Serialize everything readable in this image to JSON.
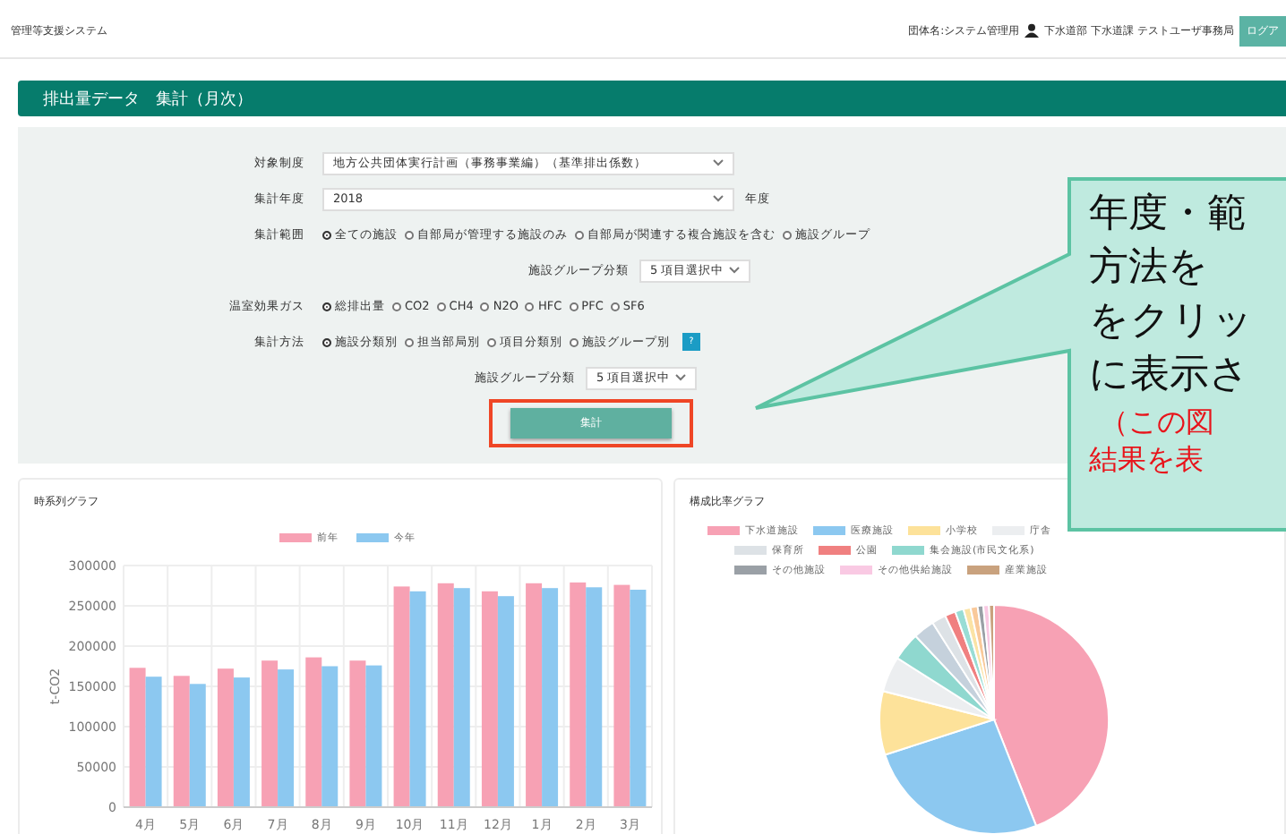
{
  "header": {
    "app_title": "管理等支援システム",
    "org_label": "団体名:システム管理用",
    "user": "下水道部 下水道課 テストユーザ事務局",
    "logout_button": "ログア"
  },
  "page_title": "排出量データ　集計（月次）",
  "form": {
    "target": {
      "label": "対象制度",
      "value": "地方公共団体実行計画（事務事業編）（基準排出係数）"
    },
    "year": {
      "label": "集計年度",
      "value": "2018",
      "suffix": "年度"
    },
    "scope": {
      "label": "集計範囲",
      "options": [
        {
          "label": "全ての施設",
          "selected": true
        },
        {
          "label": "自部局が管理する施設のみ",
          "selected": false
        },
        {
          "label": "自部局が関連する複合施設を含む",
          "selected": false
        },
        {
          "label": "施設グループ",
          "selected": false
        }
      ]
    },
    "scope_group": {
      "label": "施設グループ分類",
      "value": "5 項目選択中"
    },
    "gas": {
      "label": "温室効果ガス",
      "options": [
        {
          "label": "総排出量",
          "selected": true
        },
        {
          "label": "CO2",
          "selected": false
        },
        {
          "label": "CH4",
          "selected": false
        },
        {
          "label": "N2O",
          "selected": false
        },
        {
          "label": "HFC",
          "selected": false
        },
        {
          "label": "PFC",
          "selected": false
        },
        {
          "label": "SF6",
          "selected": false
        }
      ]
    },
    "method": {
      "label": "集計方法",
      "options": [
        {
          "label": "施設分類別",
          "selected": true
        },
        {
          "label": "担当部局別",
          "selected": false
        },
        {
          "label": "項目分類別",
          "selected": false
        },
        {
          "label": "施設グループ別",
          "selected": false
        }
      ],
      "help": "?"
    },
    "method_group": {
      "label": "施設グループ分類",
      "value": "5 項目選択中"
    },
    "submit": "集計"
  },
  "bar_card": {
    "chart_data": {
      "type": "bar",
      "title": "時系列グラフ",
      "ylabel": "t-CO2",
      "categories": [
        "4月",
        "5月",
        "6月",
        "7月",
        "8月",
        "9月",
        "10月",
        "11月",
        "12月",
        "1月",
        "2月",
        "3月"
      ],
      "series": [
        {
          "name": "前年",
          "color": "#f7a1b4",
          "values": [
            173000,
            163000,
            172000,
            182000,
            186000,
            182000,
            274000,
            278000,
            268000,
            278000,
            279000,
            276000
          ]
        },
        {
          "name": "今年",
          "color": "#8cc8f0",
          "values": [
            162000,
            153000,
            161000,
            171000,
            175000,
            176000,
            268000,
            272000,
            262000,
            272000,
            273000,
            270000
          ]
        }
      ],
      "ylim": [
        0,
        300000
      ],
      "grid": true,
      "yticks": [
        0,
        50000,
        100000,
        150000,
        200000,
        250000,
        300000
      ]
    }
  },
  "pie_card": {
    "title": "構成比率グラフ",
    "legend_rows": [
      [
        {
          "label": "下水道施設",
          "color": "#f7a1b4"
        },
        {
          "label": "医療施設",
          "color": "#8cc8f0"
        },
        {
          "label": "小学校",
          "color": "#fde29a"
        },
        {
          "label": "庁舎",
          "color": "#eceef0"
        }
      ],
      [
        {
          "label": "保育所",
          "color": "#dde2e6"
        },
        {
          "label": "公園",
          "color": "#f08080"
        },
        {
          "label": "集会施設(市民文化系)",
          "color": "#8fd8cf"
        }
      ],
      [
        {
          "label": "その他施設",
          "color": "#9aa0a6"
        },
        {
          "label": "その他供給施設",
          "color": "#f9c9e3"
        },
        {
          "label": "産業施設",
          "color": "#c9a27e"
        }
      ]
    ]
  },
  "callout": {
    "lines": [
      "年度・範",
      "方法を",
      "をクリッ",
      "に表示さ"
    ],
    "note_lines": [
      "（この図",
      "結果を表"
    ]
  }
}
